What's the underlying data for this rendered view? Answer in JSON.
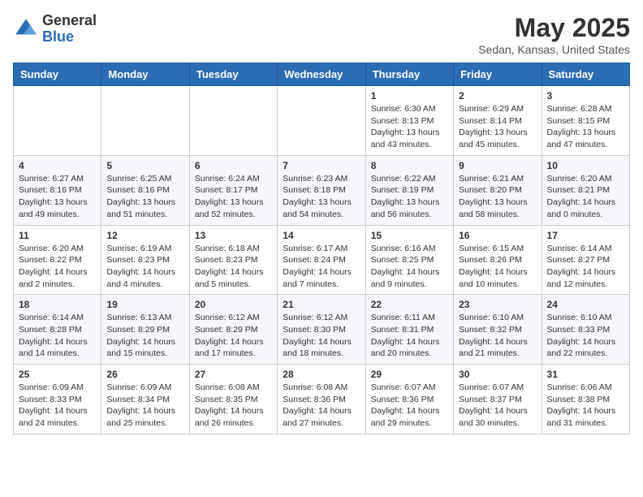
{
  "header": {
    "logo_general": "General",
    "logo_blue": "Blue",
    "title": "May 2025",
    "subtitle": "Sedan, Kansas, United States"
  },
  "weekdays": [
    "Sunday",
    "Monday",
    "Tuesday",
    "Wednesday",
    "Thursday",
    "Friday",
    "Saturday"
  ],
  "weeks": [
    [
      {
        "day": "",
        "sunrise": "",
        "sunset": "",
        "daylight": ""
      },
      {
        "day": "",
        "sunrise": "",
        "sunset": "",
        "daylight": ""
      },
      {
        "day": "",
        "sunrise": "",
        "sunset": "",
        "daylight": ""
      },
      {
        "day": "",
        "sunrise": "",
        "sunset": "",
        "daylight": ""
      },
      {
        "day": "1",
        "sunrise": "Sunrise: 6:30 AM",
        "sunset": "Sunset: 8:13 PM",
        "daylight": "Daylight: 13 hours and 43 minutes."
      },
      {
        "day": "2",
        "sunrise": "Sunrise: 6:29 AM",
        "sunset": "Sunset: 8:14 PM",
        "daylight": "Daylight: 13 hours and 45 minutes."
      },
      {
        "day": "3",
        "sunrise": "Sunrise: 6:28 AM",
        "sunset": "Sunset: 8:15 PM",
        "daylight": "Daylight: 13 hours and 47 minutes."
      }
    ],
    [
      {
        "day": "4",
        "sunrise": "Sunrise: 6:27 AM",
        "sunset": "Sunset: 8:16 PM",
        "daylight": "Daylight: 13 hours and 49 minutes."
      },
      {
        "day": "5",
        "sunrise": "Sunrise: 6:25 AM",
        "sunset": "Sunset: 8:16 PM",
        "daylight": "Daylight: 13 hours and 51 minutes."
      },
      {
        "day": "6",
        "sunrise": "Sunrise: 6:24 AM",
        "sunset": "Sunset: 8:17 PM",
        "daylight": "Daylight: 13 hours and 52 minutes."
      },
      {
        "day": "7",
        "sunrise": "Sunrise: 6:23 AM",
        "sunset": "Sunset: 8:18 PM",
        "daylight": "Daylight: 13 hours and 54 minutes."
      },
      {
        "day": "8",
        "sunrise": "Sunrise: 6:22 AM",
        "sunset": "Sunset: 8:19 PM",
        "daylight": "Daylight: 13 hours and 56 minutes."
      },
      {
        "day": "9",
        "sunrise": "Sunrise: 6:21 AM",
        "sunset": "Sunset: 8:20 PM",
        "daylight": "Daylight: 13 hours and 58 minutes."
      },
      {
        "day": "10",
        "sunrise": "Sunrise: 6:20 AM",
        "sunset": "Sunset: 8:21 PM",
        "daylight": "Daylight: 14 hours and 0 minutes."
      }
    ],
    [
      {
        "day": "11",
        "sunrise": "Sunrise: 6:20 AM",
        "sunset": "Sunset: 8:22 PM",
        "daylight": "Daylight: 14 hours and 2 minutes."
      },
      {
        "day": "12",
        "sunrise": "Sunrise: 6:19 AM",
        "sunset": "Sunset: 8:23 PM",
        "daylight": "Daylight: 14 hours and 4 minutes."
      },
      {
        "day": "13",
        "sunrise": "Sunrise: 6:18 AM",
        "sunset": "Sunset: 8:23 PM",
        "daylight": "Daylight: 14 hours and 5 minutes."
      },
      {
        "day": "14",
        "sunrise": "Sunrise: 6:17 AM",
        "sunset": "Sunset: 8:24 PM",
        "daylight": "Daylight: 14 hours and 7 minutes."
      },
      {
        "day": "15",
        "sunrise": "Sunrise: 6:16 AM",
        "sunset": "Sunset: 8:25 PM",
        "daylight": "Daylight: 14 hours and 9 minutes."
      },
      {
        "day": "16",
        "sunrise": "Sunrise: 6:15 AM",
        "sunset": "Sunset: 8:26 PM",
        "daylight": "Daylight: 14 hours and 10 minutes."
      },
      {
        "day": "17",
        "sunrise": "Sunrise: 6:14 AM",
        "sunset": "Sunset: 8:27 PM",
        "daylight": "Daylight: 14 hours and 12 minutes."
      }
    ],
    [
      {
        "day": "18",
        "sunrise": "Sunrise: 6:14 AM",
        "sunset": "Sunset: 8:28 PM",
        "daylight": "Daylight: 14 hours and 14 minutes."
      },
      {
        "day": "19",
        "sunrise": "Sunrise: 6:13 AM",
        "sunset": "Sunset: 8:29 PM",
        "daylight": "Daylight: 14 hours and 15 minutes."
      },
      {
        "day": "20",
        "sunrise": "Sunrise: 6:12 AM",
        "sunset": "Sunset: 8:29 PM",
        "daylight": "Daylight: 14 hours and 17 minutes."
      },
      {
        "day": "21",
        "sunrise": "Sunrise: 6:12 AM",
        "sunset": "Sunset: 8:30 PM",
        "daylight": "Daylight: 14 hours and 18 minutes."
      },
      {
        "day": "22",
        "sunrise": "Sunrise: 6:11 AM",
        "sunset": "Sunset: 8:31 PM",
        "daylight": "Daylight: 14 hours and 20 minutes."
      },
      {
        "day": "23",
        "sunrise": "Sunrise: 6:10 AM",
        "sunset": "Sunset: 8:32 PM",
        "daylight": "Daylight: 14 hours and 21 minutes."
      },
      {
        "day": "24",
        "sunrise": "Sunrise: 6:10 AM",
        "sunset": "Sunset: 8:33 PM",
        "daylight": "Daylight: 14 hours and 22 minutes."
      }
    ],
    [
      {
        "day": "25",
        "sunrise": "Sunrise: 6:09 AM",
        "sunset": "Sunset: 8:33 PM",
        "daylight": "Daylight: 14 hours and 24 minutes."
      },
      {
        "day": "26",
        "sunrise": "Sunrise: 6:09 AM",
        "sunset": "Sunset: 8:34 PM",
        "daylight": "Daylight: 14 hours and 25 minutes."
      },
      {
        "day": "27",
        "sunrise": "Sunrise: 6:08 AM",
        "sunset": "Sunset: 8:35 PM",
        "daylight": "Daylight: 14 hours and 26 minutes."
      },
      {
        "day": "28",
        "sunrise": "Sunrise: 6:08 AM",
        "sunset": "Sunset: 8:36 PM",
        "daylight": "Daylight: 14 hours and 27 minutes."
      },
      {
        "day": "29",
        "sunrise": "Sunrise: 6:07 AM",
        "sunset": "Sunset: 8:36 PM",
        "daylight": "Daylight: 14 hours and 29 minutes."
      },
      {
        "day": "30",
        "sunrise": "Sunrise: 6:07 AM",
        "sunset": "Sunset: 8:37 PM",
        "daylight": "Daylight: 14 hours and 30 minutes."
      },
      {
        "day": "31",
        "sunrise": "Sunrise: 6:06 AM",
        "sunset": "Sunset: 8:38 PM",
        "daylight": "Daylight: 14 hours and 31 minutes."
      }
    ]
  ]
}
